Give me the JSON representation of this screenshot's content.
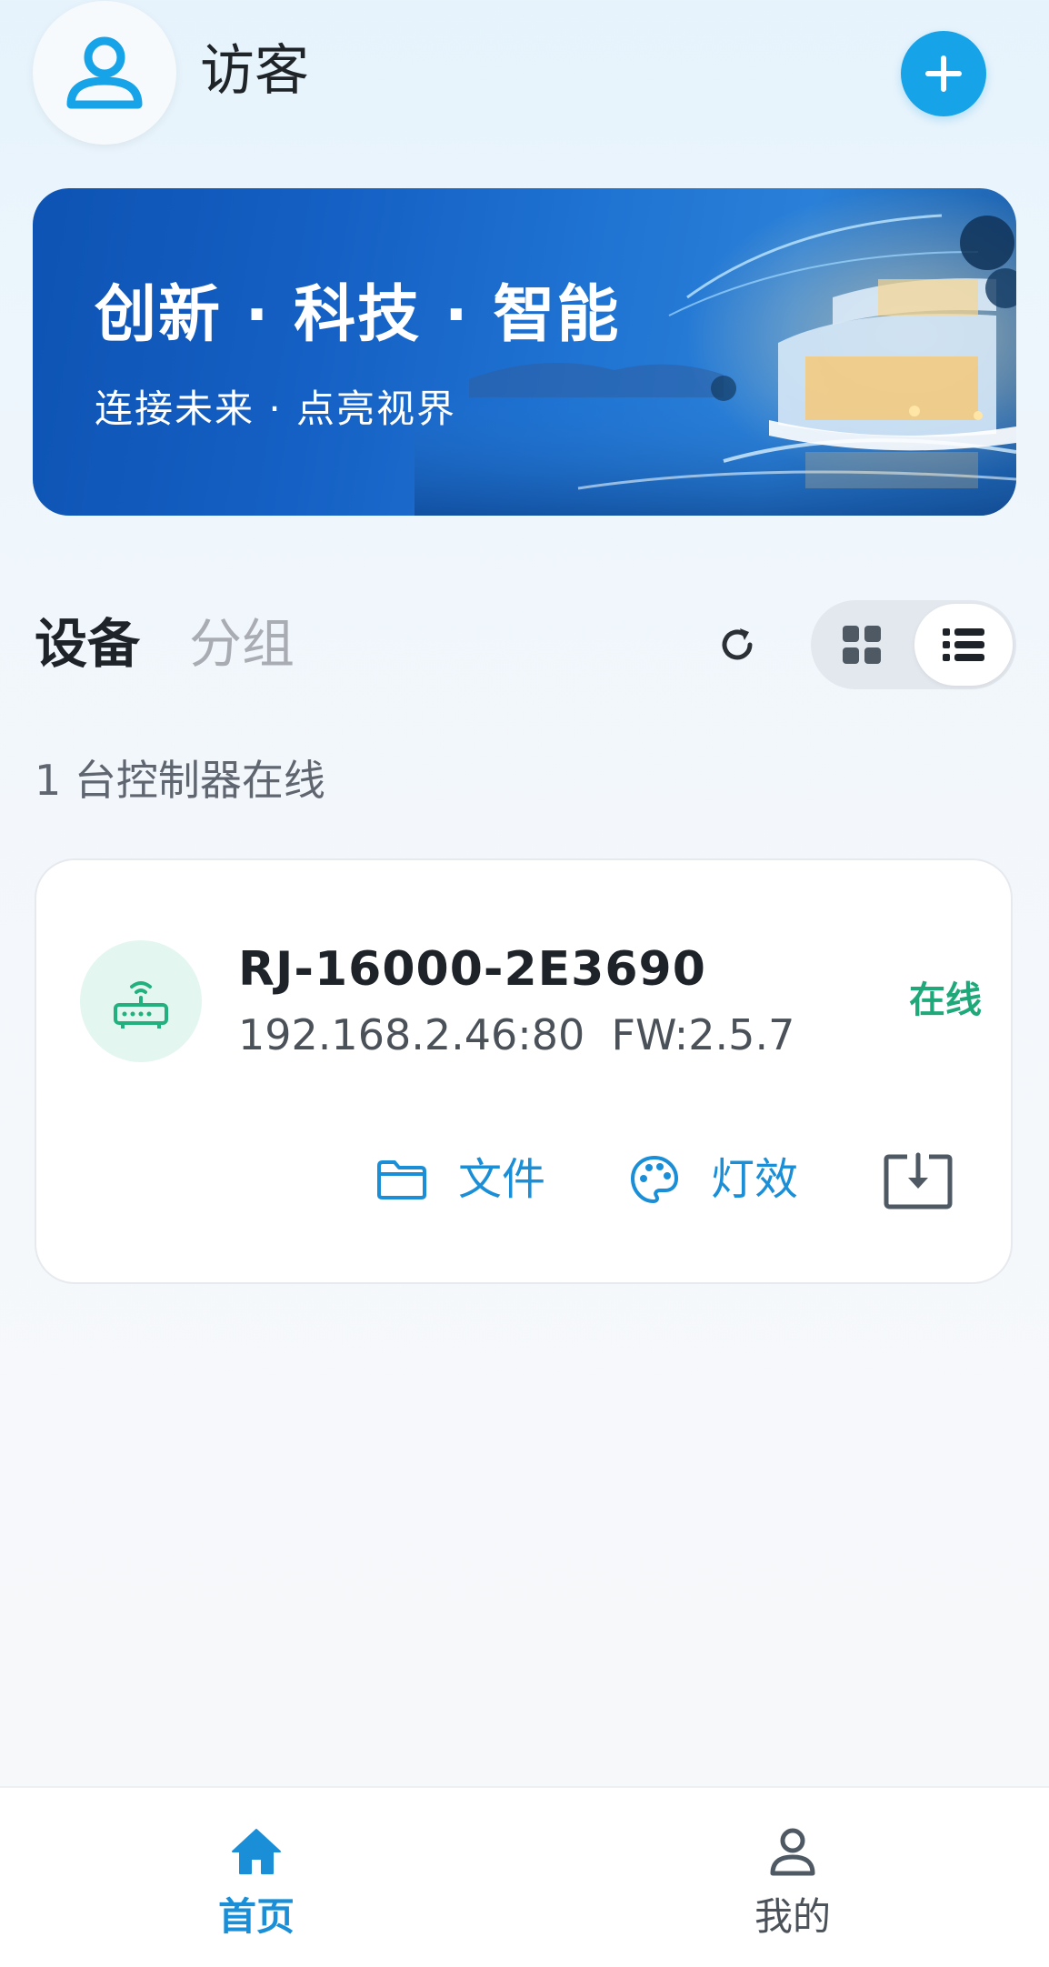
{
  "header": {
    "title": "访客"
  },
  "banner": {
    "title": "创新 · 科技 · 智能",
    "subtitle": "连接未来  ·  点亮视界"
  },
  "tabs": {
    "devices": "设备",
    "groups": "分组",
    "active": "devices"
  },
  "view_mode": "list",
  "online_count": "1 台控制器在线",
  "device": {
    "name": "RJ-16000-2E3690",
    "info": "192.168.2.46:80  FW:2.5.7",
    "status": "在线",
    "actions": {
      "files": "文件",
      "effects": "灯效"
    }
  },
  "bottom_nav": {
    "home": "首页",
    "mine": "我的",
    "active": "home"
  },
  "icons": {
    "avatar": "user-icon",
    "add": "plus-icon",
    "refresh": "refresh-icon",
    "grid": "grid-view-icon",
    "list": "list-view-icon",
    "router": "router-icon",
    "folder": "folder-icon",
    "palette": "palette-icon",
    "download": "download-icon",
    "home": "home-icon",
    "profile": "profile-icon"
  },
  "colors": {
    "accent": "#16a3e8",
    "link": "#1a8fd8",
    "online": "#1fa97a",
    "router_icon": "#22b07f",
    "text_primary": "#1e2329",
    "text_muted": "#a9adb3"
  }
}
